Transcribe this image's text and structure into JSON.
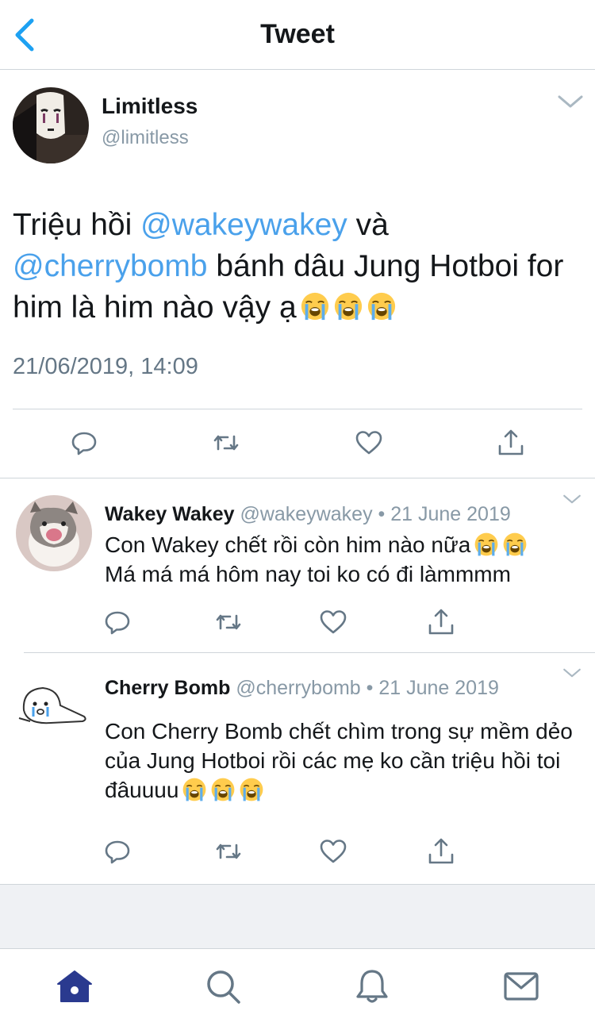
{
  "header": {
    "title": "Tweet",
    "back_icon": "chevron-left-icon"
  },
  "colors": {
    "accent": "#1da1f2",
    "mention": "#4aa1eb",
    "muted": "#8899a6",
    "divider": "#cfd5da",
    "tab_active": "#2a3a8f"
  },
  "main_tweet": {
    "name": "Limitless",
    "handle": "@limitless",
    "text_1": "Triệu hồi ",
    "mention_1": "@wakeywakey",
    "text_2": " và ",
    "mention_2": "@cherrybomb",
    "text_3": " bánh dâu Jung Hotboi for him là him nào vậy ạ",
    "emoji": [
      "loudly-crying-face",
      "loudly-crying-face",
      "loudly-crying-face"
    ],
    "timestamp": "21/06/2019, 14:09"
  },
  "replies": [
    {
      "name": "Wakey Wakey",
      "handle": "@wakeywakey",
      "date": "• 21 June 2019",
      "line_1": "Con Wakey chết rồi còn him nào nữa",
      "line_2": "Má má má hôm nay toi ko có đi làmmmm"
    },
    {
      "name": "Cherry Bomb",
      "handle": "@cherrybomb",
      "date": "• 21 June 2019",
      "text": "Con Cherry Bomb chết chìm trong sự mềm dẻo của Jung Hotboi rồi các mẹ ko cần triệu hồi toi đâuuuu"
    }
  ],
  "actions": [
    "reply-icon",
    "retweet-icon",
    "like-icon",
    "share-icon"
  ],
  "tabbar": [
    "home-icon",
    "search-icon",
    "notifications-icon",
    "messages-icon"
  ]
}
